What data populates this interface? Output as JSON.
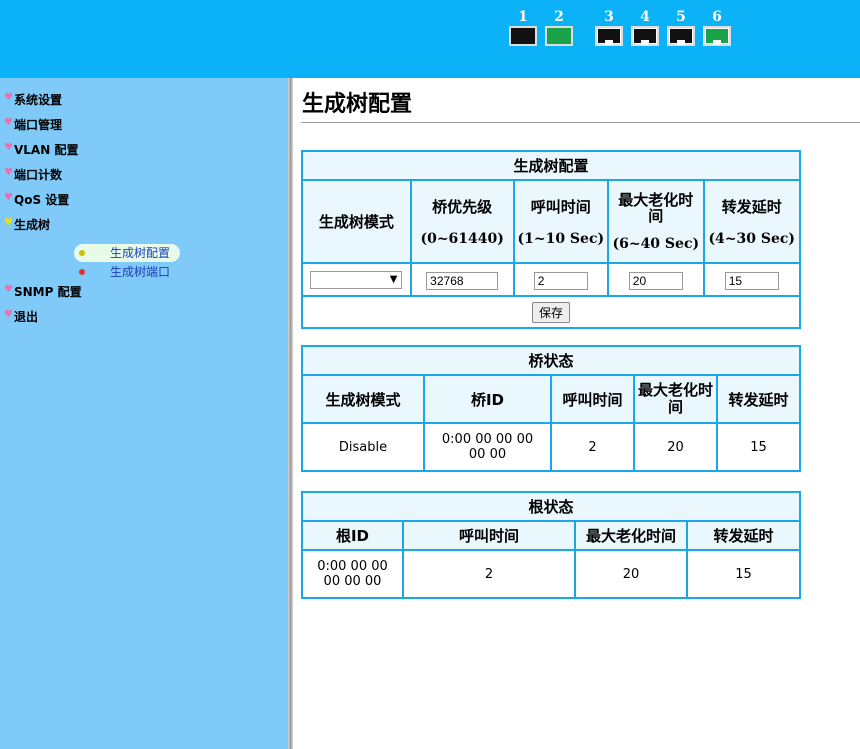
{
  "header": {
    "ports": [
      {
        "num": "1",
        "style": "black"
      },
      {
        "num": "2",
        "style": "green"
      },
      {
        "num": "3",
        "style": "rj-black"
      },
      {
        "num": "4",
        "style": "rj-black"
      },
      {
        "num": "5",
        "style": "rj-black"
      },
      {
        "num": "6",
        "style": "rj-green"
      }
    ]
  },
  "sidebar": {
    "items": [
      {
        "label": "系统设置"
      },
      {
        "label": "端口管理"
      },
      {
        "label": "VLAN 配置"
      },
      {
        "label": "端口计数"
      },
      {
        "label": "QoS 设置"
      },
      {
        "label": "生成树"
      },
      {
        "label": "SNMP 配置"
      },
      {
        "label": "退出"
      }
    ],
    "submenu": [
      {
        "label": "生成树配置"
      },
      {
        "label": "生成树端口"
      }
    ]
  },
  "page": {
    "title": "生成树配置"
  },
  "config_table": {
    "caption": "生成树配置",
    "headers": {
      "mode": "生成树模式",
      "priority": "桥优先级",
      "priority_range": "(0~61440)",
      "hello": "呼叫时间",
      "hello_range": "(1~10 Sec)",
      "maxage": "最大老化时间",
      "maxage_range": "(6~40 Sec)",
      "fwd": "转发延时",
      "fwd_range": "(4~30 Sec)"
    },
    "values": {
      "mode": "",
      "priority": "32768",
      "hello": "2",
      "maxage": "20",
      "fwd": "15"
    },
    "save_label": "保存"
  },
  "bridge_table": {
    "caption": "桥状态",
    "headers": [
      "生成树模式",
      "桥ID",
      "呼叫时间",
      "最大老化时间",
      "转发延时"
    ],
    "row": {
      "mode": "Disable",
      "bridge_id_1": "0:00 00 00 00",
      "bridge_id_2": "00 00",
      "hello": "2",
      "maxage": "20",
      "fwd": "15"
    }
  },
  "root_table": {
    "caption": "根状态",
    "headers": [
      "根ID",
      "呼叫时间",
      "最大老化时间",
      "转发延时"
    ],
    "row": {
      "root_id_1": "0:00 00 00",
      "root_id_2": "00 00 00",
      "hello": "2",
      "maxage": "20",
      "fwd": "15"
    }
  }
}
